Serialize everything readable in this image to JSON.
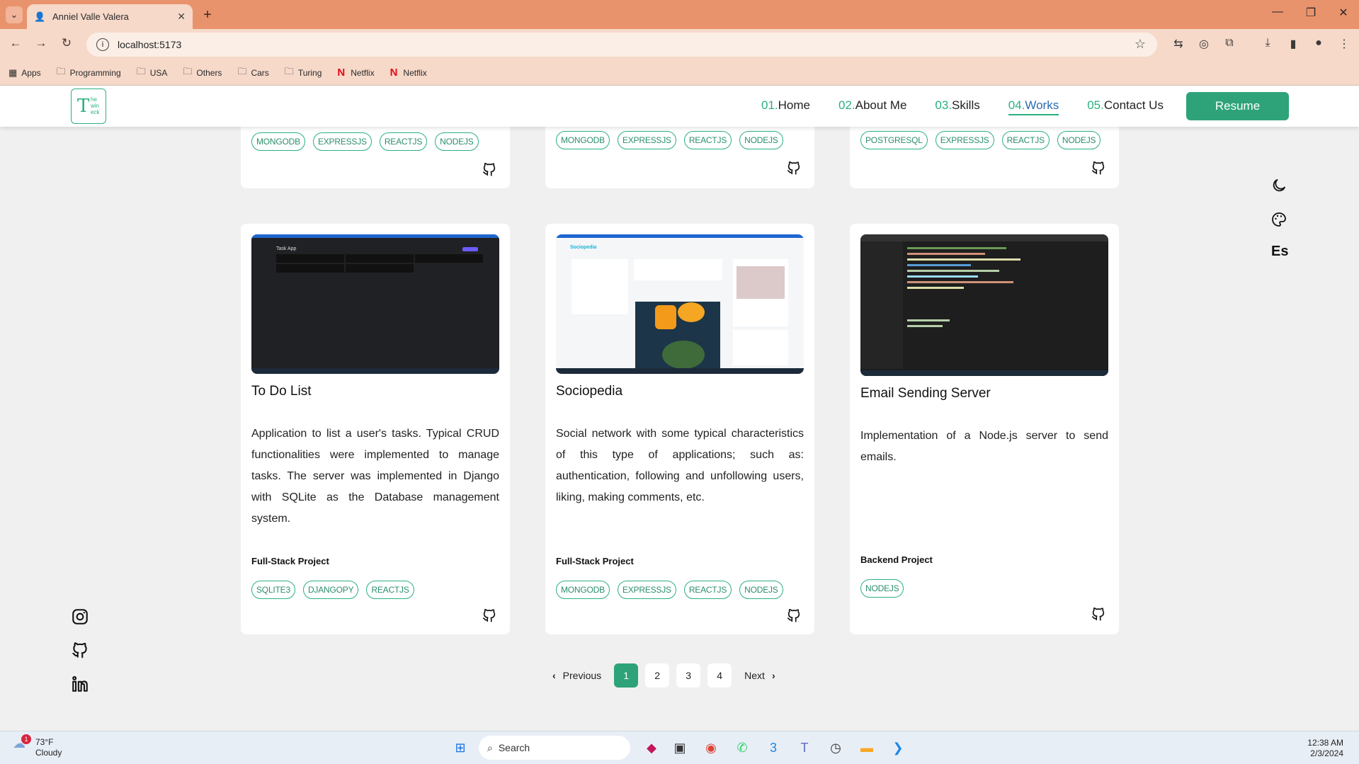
{
  "browser": {
    "tab_title": "Anniel Valle Valera",
    "url": "localhost:5173",
    "bookmarks": [
      {
        "label": "Apps",
        "icon": "grid-icon"
      },
      {
        "label": "Programming",
        "icon": "folder-icon"
      },
      {
        "label": "USA",
        "icon": "folder-icon"
      },
      {
        "label": "Others",
        "icon": "folder-icon"
      },
      {
        "label": "Cars",
        "icon": "folder-icon"
      },
      {
        "label": "Turing",
        "icon": "folder-icon"
      },
      {
        "label": "Netflix",
        "icon": "netflix-icon"
      },
      {
        "label": "Netflix",
        "icon": "netflix-icon"
      }
    ]
  },
  "header": {
    "logo": {
      "big": "T",
      "small": "he win eck"
    },
    "nav": [
      {
        "num": "01.",
        "label": "Home"
      },
      {
        "num": "02.",
        "label": "About Me"
      },
      {
        "num": "03.",
        "label": "Skills"
      },
      {
        "num": "04.",
        "label": "Works"
      },
      {
        "num": "05.",
        "label": "Contact Us"
      }
    ],
    "resume_label": "Resume"
  },
  "top_cards": [
    {
      "tags": [
        "MONGODB",
        "EXPRESSJS",
        "REACTJS",
        "NODEJS"
      ]
    },
    {
      "tags": [
        "MONGODB",
        "EXPRESSJS",
        "REACTJS",
        "NODEJS"
      ]
    },
    {
      "tags": [
        "POSTGRESQL",
        "EXPRESSJS",
        "REACTJS",
        "NODEJS"
      ]
    }
  ],
  "projects": [
    {
      "title": "To Do List",
      "description": "Application to list a user's tasks. Typical CRUD functionalities were implemented to manage tasks. The server was implemented in Django with SQLite as the Database management system.",
      "type": "Full-Stack Project",
      "tags": [
        "SQLITE3",
        "DJANGOPY",
        "REACTJS"
      ],
      "screenshot_title": "Task App"
    },
    {
      "title": "Sociopedia",
      "description": "Social network with some typical characteristics of this type of applications; such as: authentication, following and unfollowing users, liking, making comments, etc.",
      "type": "Full-Stack Project",
      "tags": [
        "MONGODB",
        "EXPRESSJS",
        "REACTJS",
        "NODEJS"
      ],
      "screenshot_title": "Sociopedia"
    },
    {
      "title": "Email Sending Server",
      "description": "Implementation of a Node.js server to send emails.",
      "type": "Backend Project",
      "tags": [
        "NODEJS"
      ],
      "screenshot_title": ""
    }
  ],
  "right_tools": {
    "language": "Es"
  },
  "pagination": {
    "previous": "Previous",
    "next": "Next",
    "pages": [
      "1",
      "2",
      "3",
      "4"
    ],
    "current": "1"
  },
  "taskbar": {
    "weather_temp": "73°F",
    "weather_desc": "Cloudy",
    "weather_badge": "1",
    "search_placeholder": "Search",
    "time": "12:38 AM",
    "date": "2/3/2024"
  },
  "colors": {
    "accent": "#2ea37a",
    "tag_border": "#2bb07e",
    "chrome": "#e9936c"
  }
}
